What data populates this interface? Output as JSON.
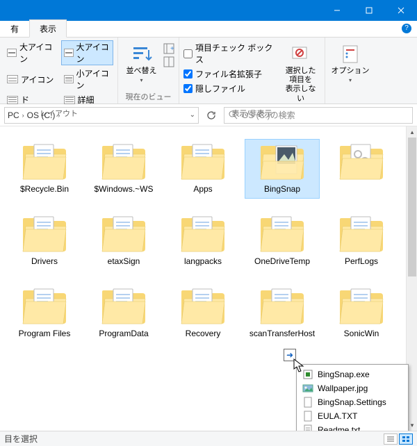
{
  "titlebar": {
    "minimize": "–",
    "maximize": "▢",
    "close": "✕"
  },
  "tabs": {
    "manage": "有",
    "view": "表示"
  },
  "ribbon": {
    "layout_group": "レイアウト",
    "layouts": {
      "extra_large": "大アイコン",
      "large": "大アイコン",
      "medium": "アイコン",
      "small": "小アイコン",
      "list": "ド",
      "details": "詳細"
    },
    "sort": {
      "label": "並べ替え"
    },
    "current_view_group": "現在のビュー",
    "checks": {
      "item_checkboxes": "項目チェック ボックス",
      "filename_ext": "ファイル名拡張子",
      "hidden": "隠しファイル"
    },
    "hide_selected": "選択した項目を\n表示しない",
    "show_hide_group": "表示/非表示",
    "options": "オプション"
  },
  "address": {
    "pc": "PC",
    "drive": "OS (C:)",
    "search_placeholder": "OS (C:)の検索"
  },
  "files": [
    {
      "name": "$Recycle.Bin",
      "type": "folder"
    },
    {
      "name": "$Windows.~WS",
      "type": "folder"
    },
    {
      "name": "Apps",
      "type": "folder"
    },
    {
      "name": "BingSnap",
      "type": "folder-preview",
      "selected": true
    },
    {
      "name": "",
      "type": "folder-gear"
    },
    {
      "name": "Drivers",
      "type": "folder"
    },
    {
      "name": "etaxSign",
      "type": "folder"
    },
    {
      "name": "langpacks",
      "type": "folder"
    },
    {
      "name": "OneDriveTemp",
      "type": "folder"
    },
    {
      "name": "PerfLogs",
      "type": "folder"
    },
    {
      "name": "Program Files",
      "type": "folder"
    },
    {
      "name": "ProgramData",
      "type": "folder"
    },
    {
      "name": "Recovery",
      "type": "folder"
    },
    {
      "name": "scanTransferHost",
      "type": "folder"
    },
    {
      "name": "SonicWin",
      "type": "folder"
    }
  ],
  "popup": [
    {
      "icon": "exe",
      "name": "BingSnap.exe"
    },
    {
      "icon": "img",
      "name": "Wallpaper.jpg"
    },
    {
      "icon": "file",
      "name": "BingSnap.Settings"
    },
    {
      "icon": "file",
      "name": "EULA.TXT"
    },
    {
      "icon": "txt",
      "name": "Readme.txt"
    }
  ],
  "status": {
    "text": "目を選択",
    "details_icon": "≡",
    "large_icon": "▦"
  }
}
